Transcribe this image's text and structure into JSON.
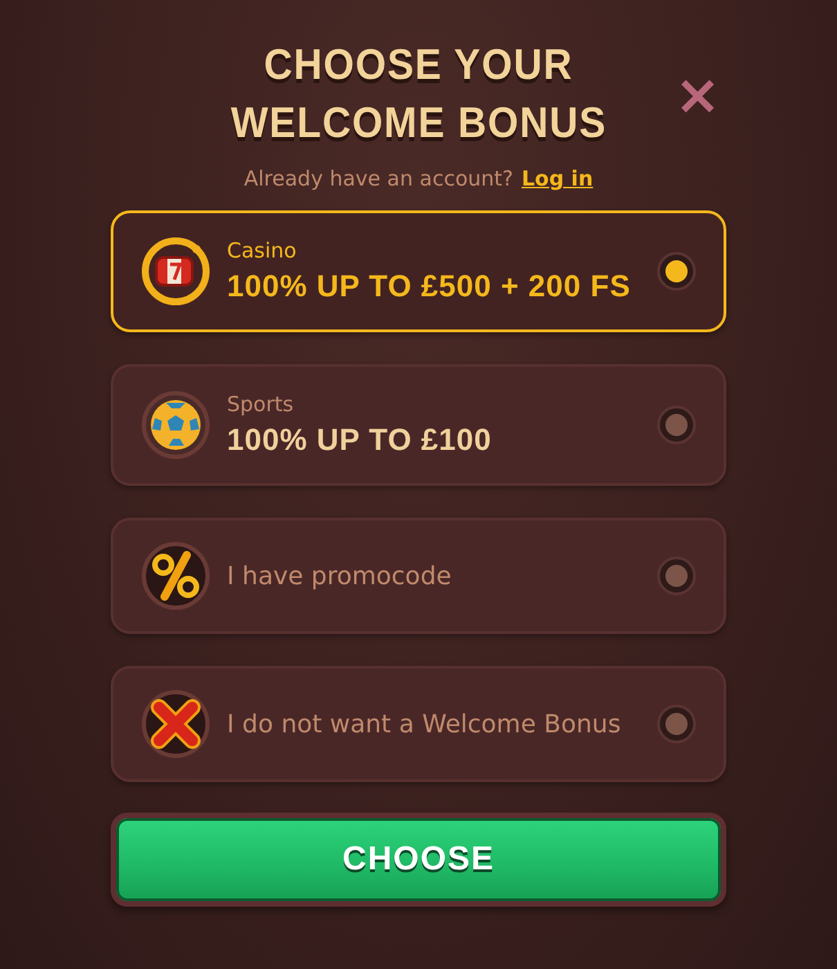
{
  "title_lines": [
    "CHOOSE YOUR",
    "WELCOME BONUS"
  ],
  "close": {
    "label": "×"
  },
  "login_prompt": {
    "text": "Already have an account?",
    "link": "Log in"
  },
  "options": [
    {
      "kind": "bonus",
      "label": "Casino",
      "headline": "100% UP TO £500 + 200 FS",
      "selected": true
    },
    {
      "kind": "bonus",
      "label": "Sports",
      "headline": "100% UP TO £100",
      "selected": false
    },
    {
      "kind": "plain",
      "label": "I have promocode",
      "selected": false
    },
    {
      "kind": "plain",
      "label": "I do not want a Welcome Bonus",
      "selected": false
    }
  ],
  "button": {
    "label": "CHOOSE"
  }
}
